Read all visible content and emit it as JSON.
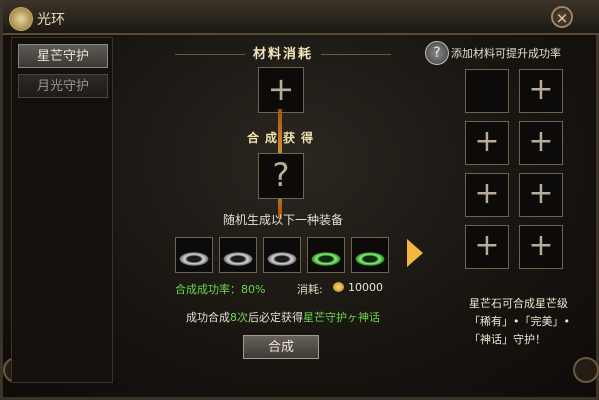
{
  "window": {
    "title": "光环",
    "close_label": "×"
  },
  "sidebar": {
    "tabs": [
      {
        "label": "星芒守护",
        "active": true
      },
      {
        "label": "月光守护",
        "active": false
      }
    ]
  },
  "main": {
    "header": "材料消耗",
    "material_slot": "+",
    "mid_label": "合成获得",
    "result_slot": "?",
    "random_text": "随机生成以下一种装备",
    "items": [
      {
        "type": "silver-ring"
      },
      {
        "type": "silver-ring"
      },
      {
        "type": "silver-ring"
      },
      {
        "type": "green-ring"
      },
      {
        "type": "green-ring"
      }
    ],
    "rate_label": "合成成功率：80%",
    "cost_label": "消耗:",
    "cost_value": "10000",
    "guarantee": {
      "pre": "成功合成",
      "count": "8次",
      "mid": "后必定获得",
      "reward": "星芒守护ヶ神话"
    },
    "craft_button": "合成"
  },
  "right_panel": {
    "title": "添加材料可提升成功率",
    "help": "?",
    "slots": [
      "",
      "+",
      "+",
      "+",
      "+",
      "+",
      "+",
      "+"
    ],
    "description": "星芒石可合成星芒级「稀有」•「完美」•「神话」守护！"
  },
  "colors": {
    "accent_green": "#6ad84a",
    "arrow": "#f3b640",
    "gold": "#f0e4bc"
  }
}
